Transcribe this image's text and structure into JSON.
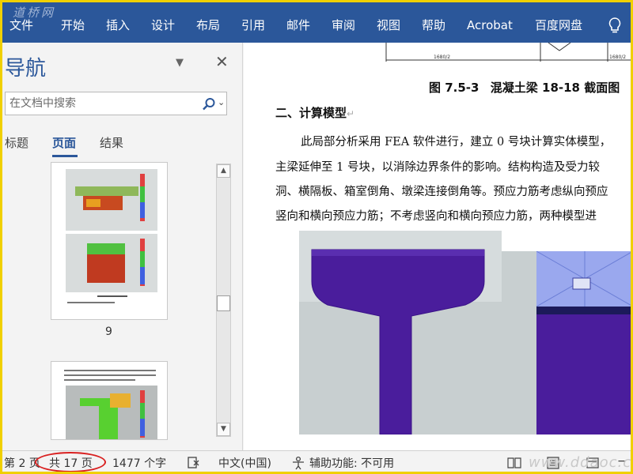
{
  "ribbon": {
    "watermark": "道桥网",
    "tabs": [
      "文件",
      "开始",
      "插入",
      "设计",
      "布局",
      "引用",
      "邮件",
      "审阅",
      "视图",
      "帮助",
      "Acrobat",
      "百度网盘"
    ]
  },
  "nav": {
    "title": "导航",
    "search_placeholder": "在文档中搜索",
    "tabs": [
      "标题",
      "页面",
      "结果"
    ],
    "active_tab": "页面",
    "page_number": "9"
  },
  "document": {
    "drawing_dims": [
      "1680/2",
      "1680/2"
    ],
    "caption_num": "图 7.5-3",
    "caption_text": "混凝土梁 18-18 截面图",
    "heading": "二、计算模型",
    "para_lines": [
      "此局部分析采用 FEA 软件进行，建立 0 号块计算实体模型，",
      "主梁延伸至 1 号块，以消除边界条件的影响。结构构造及受力较",
      "洞、横隔板、箱室倒角、墩梁连接倒角等。预应力筋考虑纵向预应",
      "竖向和横向预应力筋；不考虑竖向和横向预应力筋，两种模型进"
    ]
  },
  "status": {
    "page": "第 2 页",
    "total": "共 17 页",
    "words": "1477 个字",
    "language": "中文(中国)",
    "accessibility": "辅助功能: 不可用",
    "site_watermark": "www.ddaoc.com"
  },
  "colors": {
    "ribbon": "#2b579a",
    "frame": "#f0d000",
    "highlight_circle": "#d92020"
  }
}
